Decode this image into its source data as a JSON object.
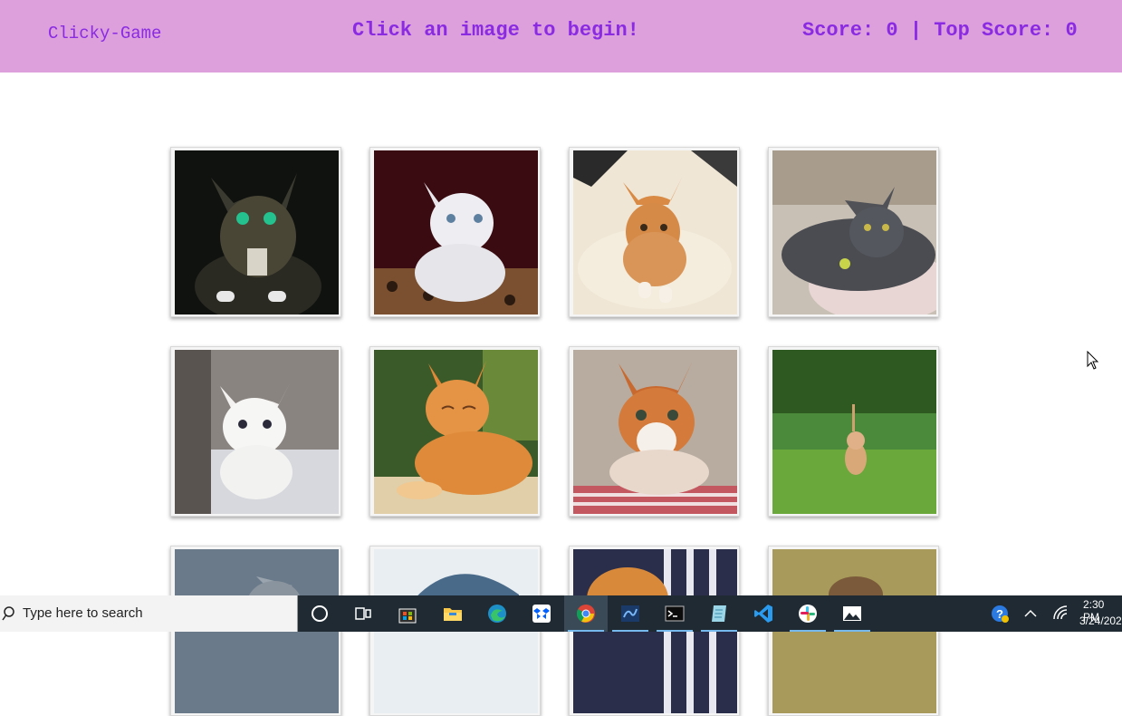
{
  "navbar": {
    "brand": "Clicky-Game",
    "message": "Click an image to begin!",
    "score_text": "Score: 0 | Top Score: 0",
    "background": "#dda0dd",
    "text_color": "#8a2be2"
  },
  "cards": [
    {
      "subject": "tabby cat with green eyes on dark background"
    },
    {
      "subject": "white kitten on leopard-print cushion"
    },
    {
      "subject": "orange tabby kitten lying on pillow"
    },
    {
      "subject": "grey cat lying on blanket"
    },
    {
      "subject": "fluffy white kitten on floor"
    },
    {
      "subject": "orange cat resting with eyes closed"
    },
    {
      "subject": "orange and white kitten on striped cloth"
    },
    {
      "subject": "small kitten walking in green grass"
    },
    {
      "subject": "grey cat partially visible"
    },
    {
      "subject": "cat under blue denim partially visible"
    },
    {
      "subject": "orange kitten with striped background partially visible"
    },
    {
      "subject": "tabby kitten outdoors partially visible"
    }
  ],
  "taskbar": {
    "search_placeholder": "Type here to search",
    "time": "2:30 PM",
    "date": "3/24/202",
    "apps": [
      "cortana-icon",
      "task-view-icon",
      "store-icon",
      "file-explorer-icon",
      "edge-icon",
      "dropbox-icon",
      "chrome-icon",
      "code-editor-icon",
      "terminal-icon",
      "notepad-icon",
      "vscode-icon",
      "slack-icon",
      "photos-icon"
    ],
    "tray": [
      "help-icon",
      "chevron-up-icon",
      "network-icon"
    ]
  }
}
